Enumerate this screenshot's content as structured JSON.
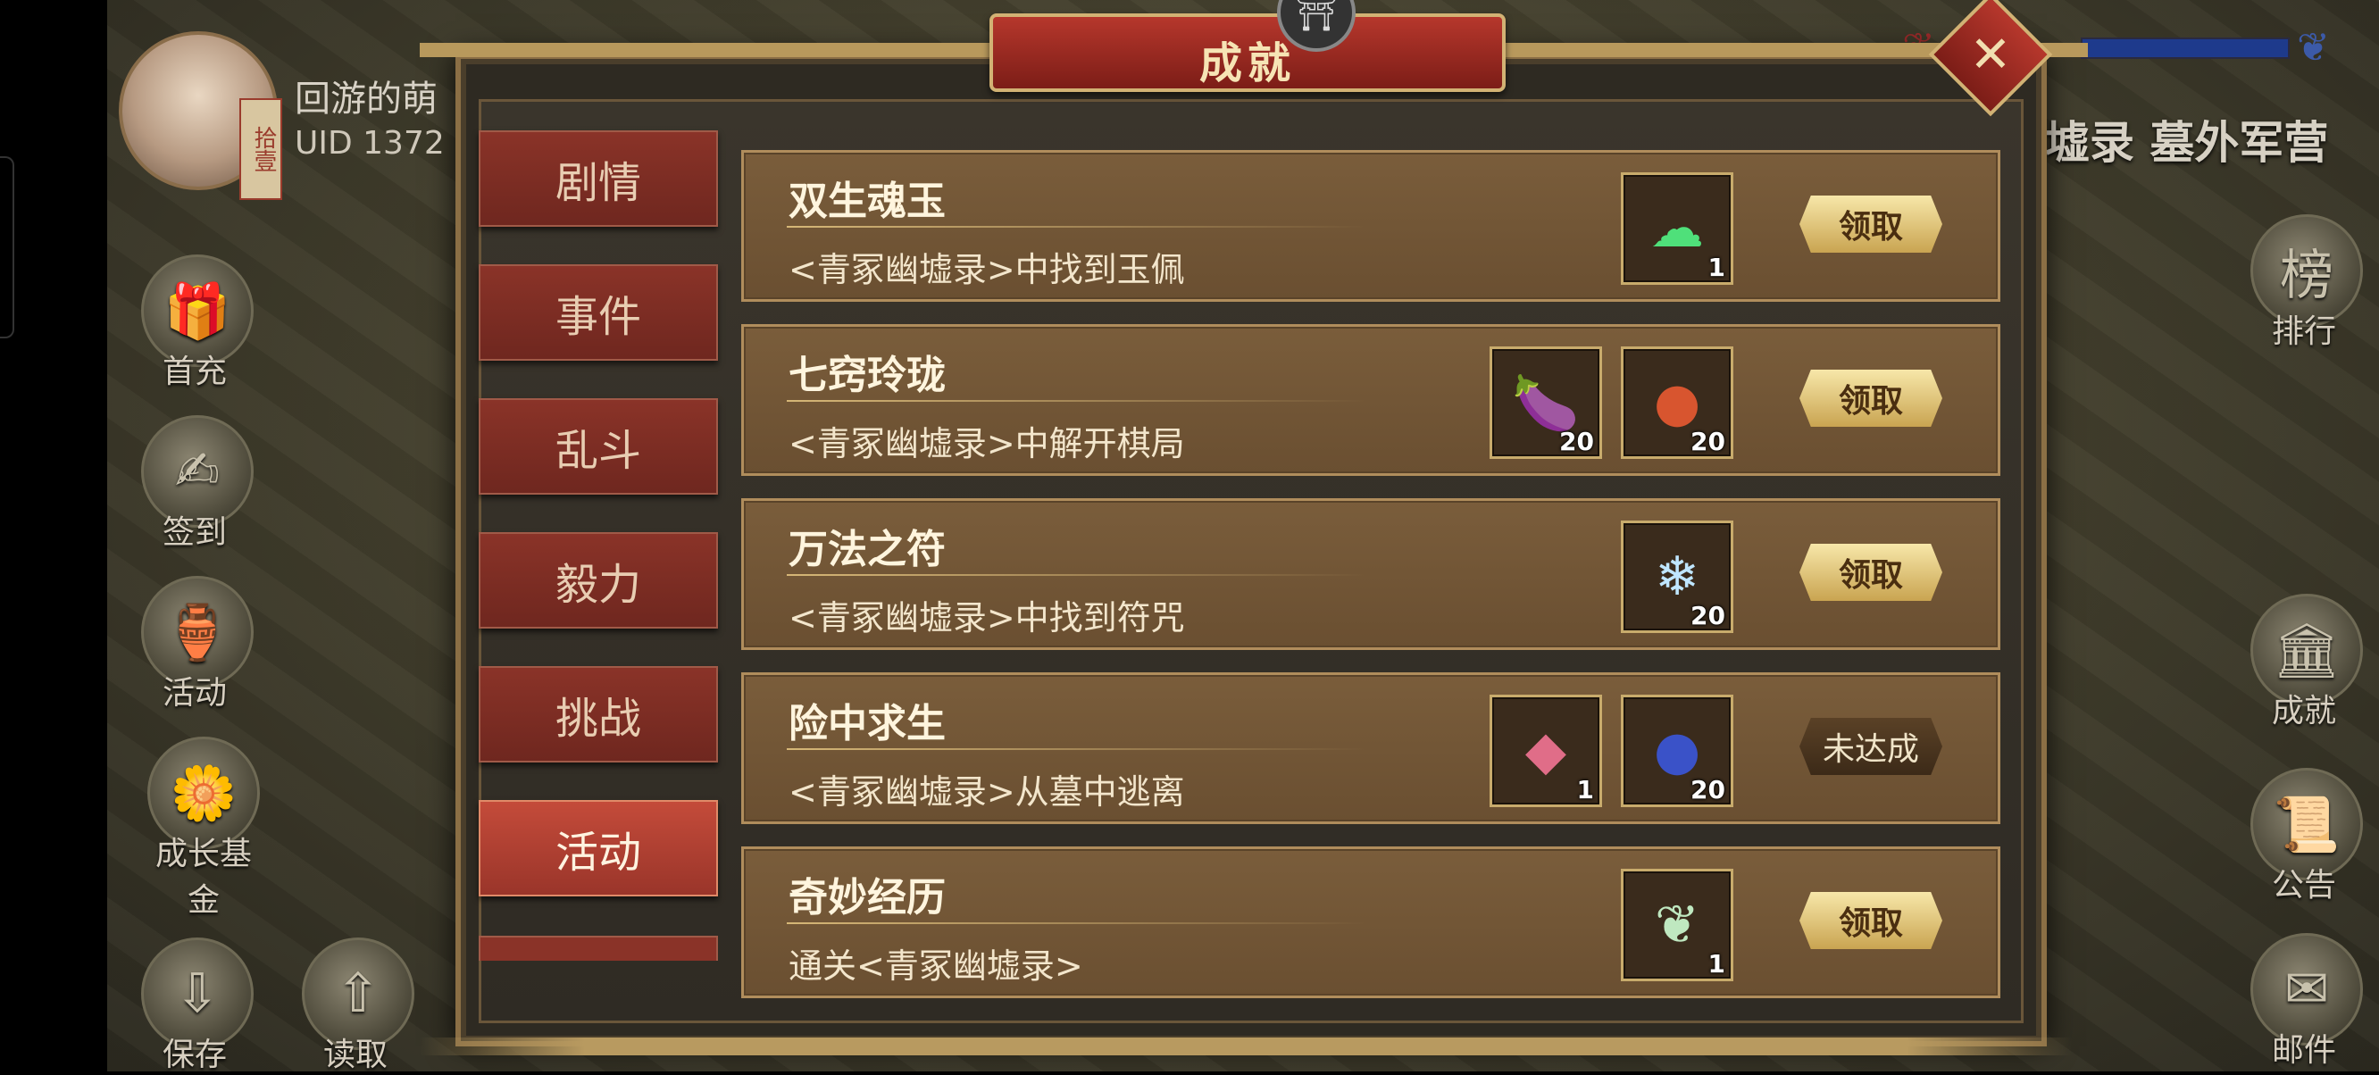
{
  "player": {
    "name": "回游的萌",
    "uid": "UID 1372",
    "avatar_tag": "拾壹"
  },
  "location": "墟录 墓外军营",
  "left_menu": [
    {
      "label": "首充",
      "icon": "🎁"
    },
    {
      "label": "签到",
      "icon": "✍"
    },
    {
      "label": "活动",
      "icon": "🏺"
    },
    {
      "label": "成长基金",
      "icon": "🌼"
    }
  ],
  "bottom_left": [
    {
      "label": "保存",
      "icon": "⇩"
    },
    {
      "label": "读取",
      "icon": "⇧"
    }
  ],
  "right_menu": [
    {
      "label": "排行",
      "icon": "榜"
    },
    {
      "label": "成就",
      "icon": "🏛"
    },
    {
      "label": "公告",
      "icon": "📜"
    },
    {
      "label": "邮件",
      "icon": "✉"
    }
  ],
  "panel": {
    "title": "成就",
    "close": "✕",
    "emblem": "⛩"
  },
  "tabs": [
    {
      "label": "剧情",
      "active": false
    },
    {
      "label": "事件",
      "active": false
    },
    {
      "label": "乱斗",
      "active": false
    },
    {
      "label": "毅力",
      "active": false
    },
    {
      "label": "挑战",
      "active": false
    },
    {
      "label": "活动",
      "active": true
    }
  ],
  "achievements": [
    {
      "name": "双生魂玉",
      "desc": "<青冢幽墟录>中找到玉佩",
      "items": [
        {
          "icon": "jade-pendant-icon",
          "glyph": "☁",
          "color": "#4fe07a",
          "count": "1"
        }
      ],
      "button": "领取",
      "claimable": true
    },
    {
      "name": "七窍玲珑",
      "desc": "<青冢幽墟录>中解开棋局",
      "items": [
        {
          "icon": "eggplant-icon",
          "glyph": "🍆",
          "color": "#6a2b8c",
          "count": "20"
        },
        {
          "icon": "pomegranate-icon",
          "glyph": "●",
          "color": "#d8552f",
          "count": "20"
        }
      ],
      "button": "领取",
      "claimable": true
    },
    {
      "name": "万法之符",
      "desc": "<青冢幽墟录>中找到符咒",
      "items": [
        {
          "icon": "ice-crystal-icon",
          "glyph": "❄",
          "color": "#bfe6ff",
          "count": "20"
        }
      ],
      "button": "领取",
      "claimable": true
    },
    {
      "name": "险中求生",
      "desc": "<青冢幽墟录>从墓中逃离",
      "items": [
        {
          "icon": "pink-gem-icon",
          "glyph": "◆",
          "color": "#e06d88",
          "count": "1"
        },
        {
          "icon": "blueberry-icon",
          "glyph": "●",
          "color": "#2a3fa8",
          "count": "20"
        }
      ],
      "button": "未达成",
      "claimable": false
    },
    {
      "name": "奇妙经历",
      "desc": "通关<青冢幽墟录>",
      "items": [
        {
          "icon": "leaf-feather-icon",
          "glyph": "❦",
          "color": "#bfe8c0",
          "count": "1"
        }
      ],
      "button": "领取",
      "claimable": true
    }
  ]
}
